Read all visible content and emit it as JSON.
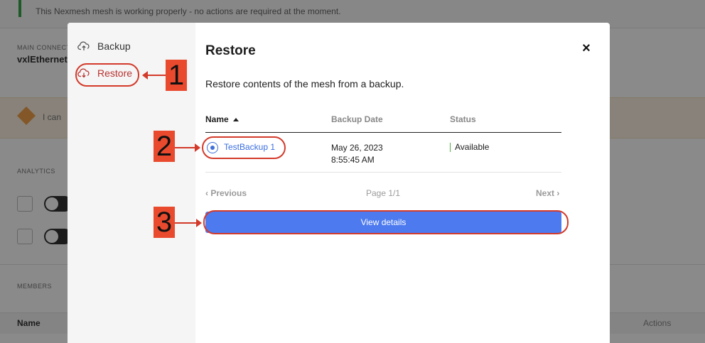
{
  "background": {
    "notice_text": "This Nexmesh mesh is working properly - no actions are required at the moment.",
    "section_label": "MAIN CONNECTION",
    "interface_name": "vxlEthernet",
    "warning_text": "I can",
    "analytics_label": "ANALYTICS",
    "members_label": "MEMBERS",
    "table_name_header": "Name",
    "table_actions_header": "Actions"
  },
  "modal": {
    "sidebar": {
      "items": [
        {
          "label": "Backup",
          "icon": "cloud-upload-icon"
        },
        {
          "label": "Restore",
          "icon": "cloud-download-icon"
        }
      ]
    },
    "title": "Restore",
    "close_glyph": "×",
    "description": "Restore contents of the mesh from a backup.",
    "table": {
      "columns": [
        "Name",
        "Backup Date",
        "Status"
      ],
      "rows": [
        {
          "name": "TestBackup 1",
          "date_line1": "May 26, 2023",
          "date_line2": "8:55:45 AM",
          "status": "Available",
          "selected": true
        }
      ]
    },
    "pager": {
      "prev": "‹ Previous",
      "page": "Page 1/1",
      "next": "Next ›"
    },
    "view_details_label": "View details"
  },
  "annotations": {
    "labels": [
      "1",
      "2",
      "3"
    ],
    "color": "#d33a2a"
  },
  "colors": {
    "accent": "#4d7aef",
    "link": "#3a6ee0",
    "restore_active": "#b8312f",
    "status_ok": "#52b043"
  }
}
